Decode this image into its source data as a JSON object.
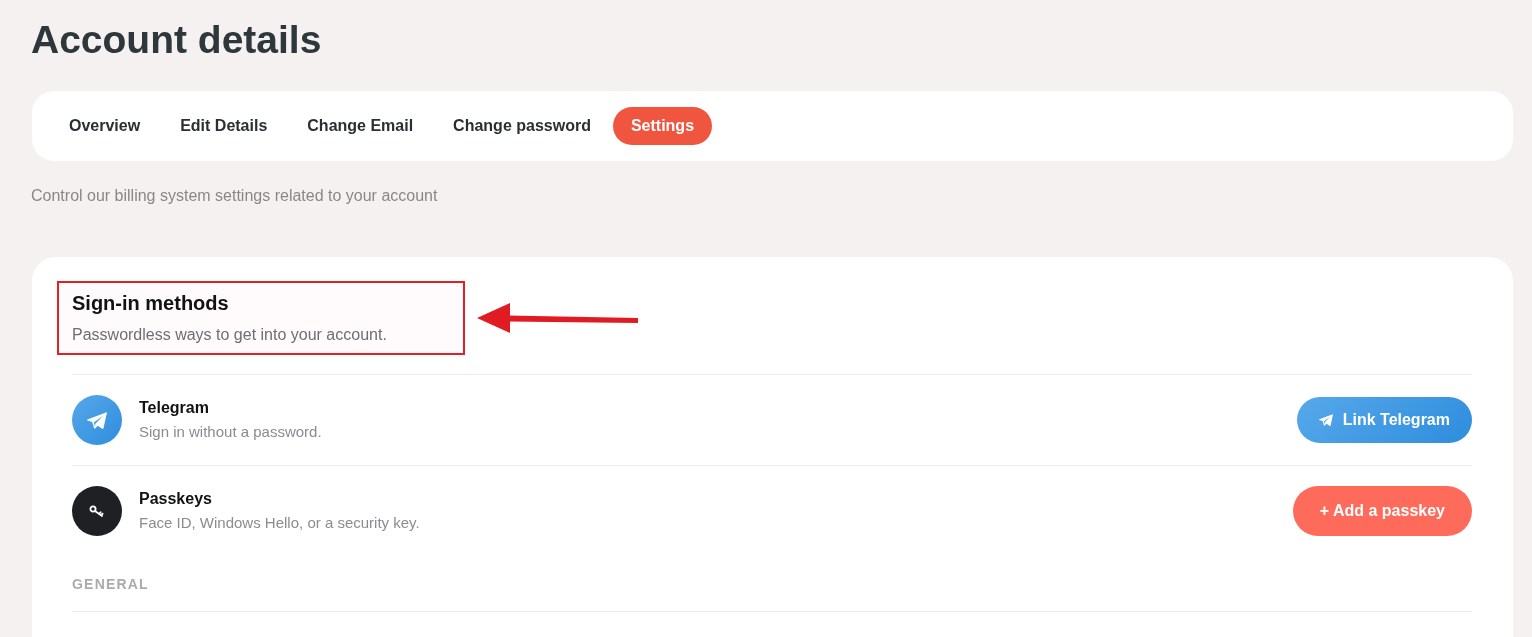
{
  "page": {
    "title": "Account details"
  },
  "tabs": [
    {
      "label": "Overview",
      "selected": false
    },
    {
      "label": "Edit Details",
      "selected": false
    },
    {
      "label": "Change Email",
      "selected": false
    },
    {
      "label": "Change password",
      "selected": false
    },
    {
      "label": "Settings",
      "selected": true
    }
  ],
  "intro": "Control our billing system settings related to your account",
  "sign_in_methods": {
    "title": "Sign-in methods",
    "description": "Passwordless ways to get into your account.",
    "highlighted": true,
    "methods": [
      {
        "kind": "telegram",
        "name": "Telegram",
        "description": "Sign in without a password.",
        "button": "Link Telegram"
      },
      {
        "kind": "passkey",
        "name": "Passkeys",
        "description": "Face ID, Windows Hello, or a security key.",
        "button": "+ Add a passkey"
      }
    ]
  },
  "general": {
    "title": "GENERAL"
  }
}
